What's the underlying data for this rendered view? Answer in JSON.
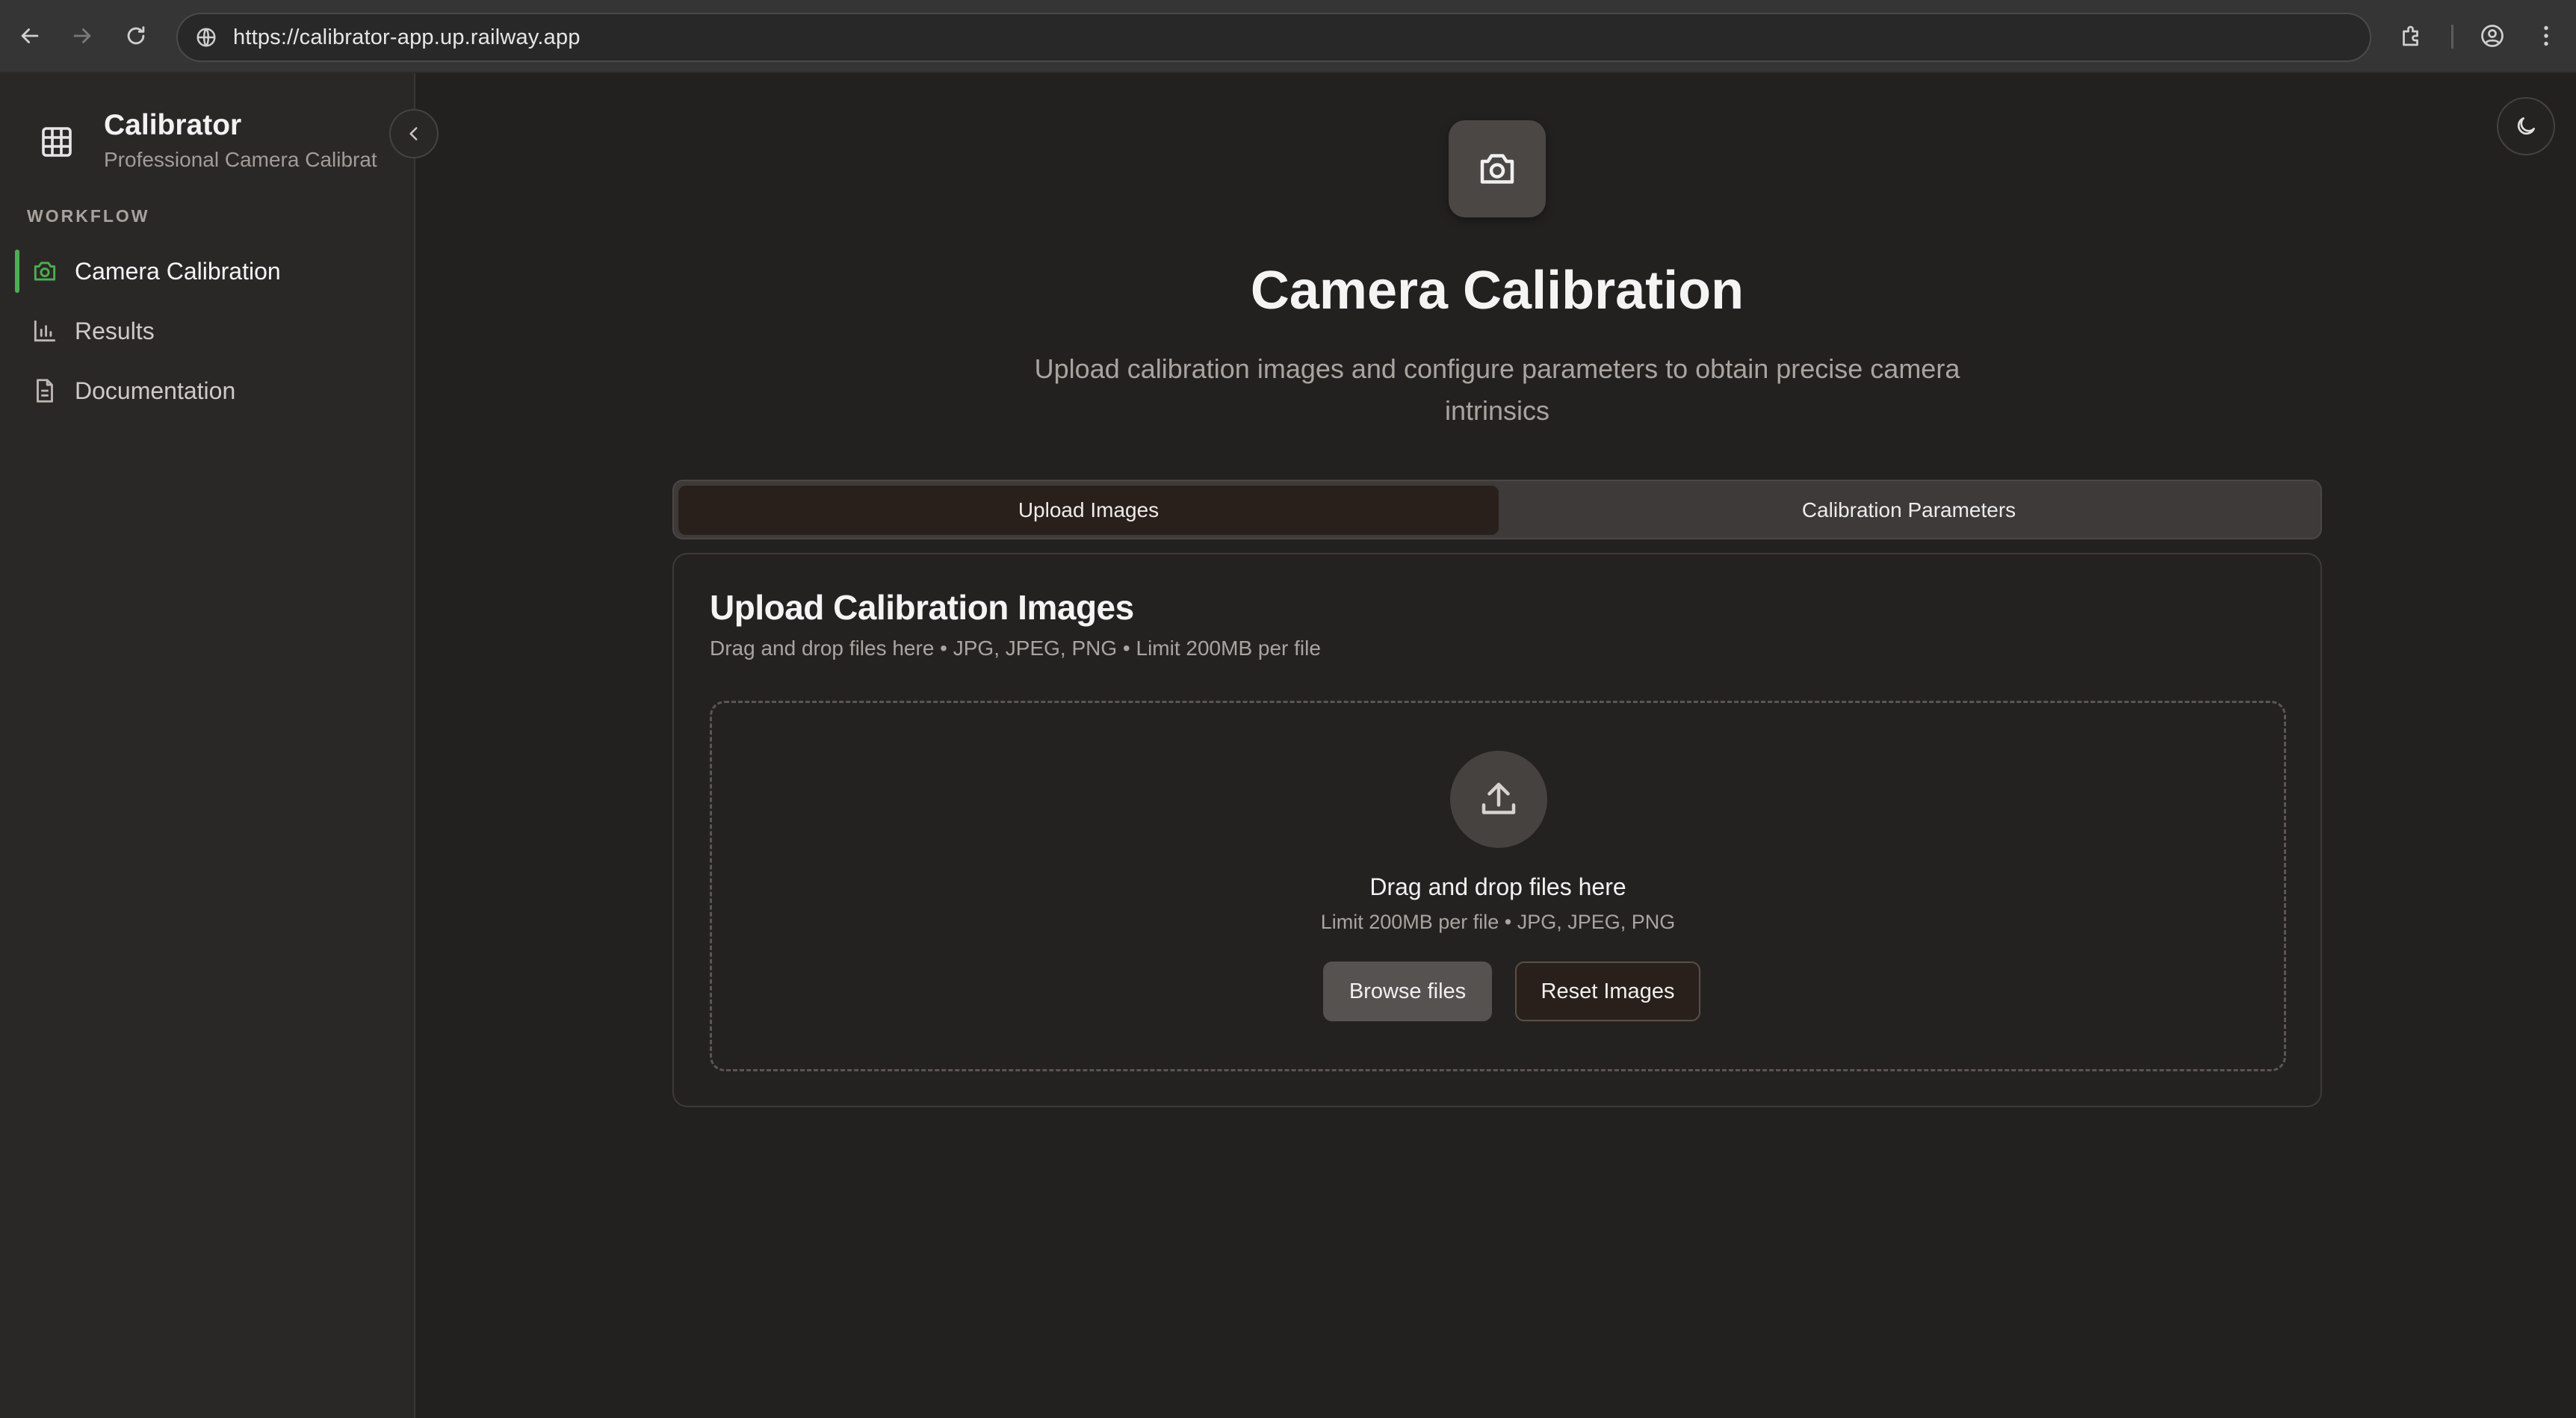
{
  "browser": {
    "url": "https://calibrator-app.up.railway.app",
    "icons": [
      "back-arrow-icon",
      "forward-arrow-icon",
      "reload-icon",
      "site-info-icon",
      "extensions-icon",
      "profile-icon",
      "more-menu-icon"
    ]
  },
  "sidebar": {
    "brand_title": "Calibrator",
    "brand_subtitle": "Professional Camera Calibrat",
    "section_label": "WORKFLOW",
    "items": [
      {
        "label": "Camera Calibration",
        "icon": "camera-icon",
        "active": true
      },
      {
        "label": "Results",
        "icon": "bar-chart-icon",
        "active": false
      },
      {
        "label": "Documentation",
        "icon": "document-icon",
        "active": false
      }
    ],
    "accent_color": "#4caf50"
  },
  "main": {
    "title": "Camera Calibration",
    "subtitle": "Upload calibration images and configure parameters to obtain precise camera intrinsics",
    "tabs": [
      {
        "label": "Upload Images",
        "active": true
      },
      {
        "label": "Calibration Parameters",
        "active": false
      }
    ],
    "card": {
      "title": "Upload Calibration Images",
      "subtitle": "Drag and drop files here • JPG, JPEG, PNG • Limit 200MB per file",
      "dropzone": {
        "title": "Drag and drop files here",
        "subtitle": "Limit 200MB per file • JPG, JPEG, PNG",
        "browse_label": "Browse files",
        "reset_label": "Reset Images"
      }
    }
  }
}
